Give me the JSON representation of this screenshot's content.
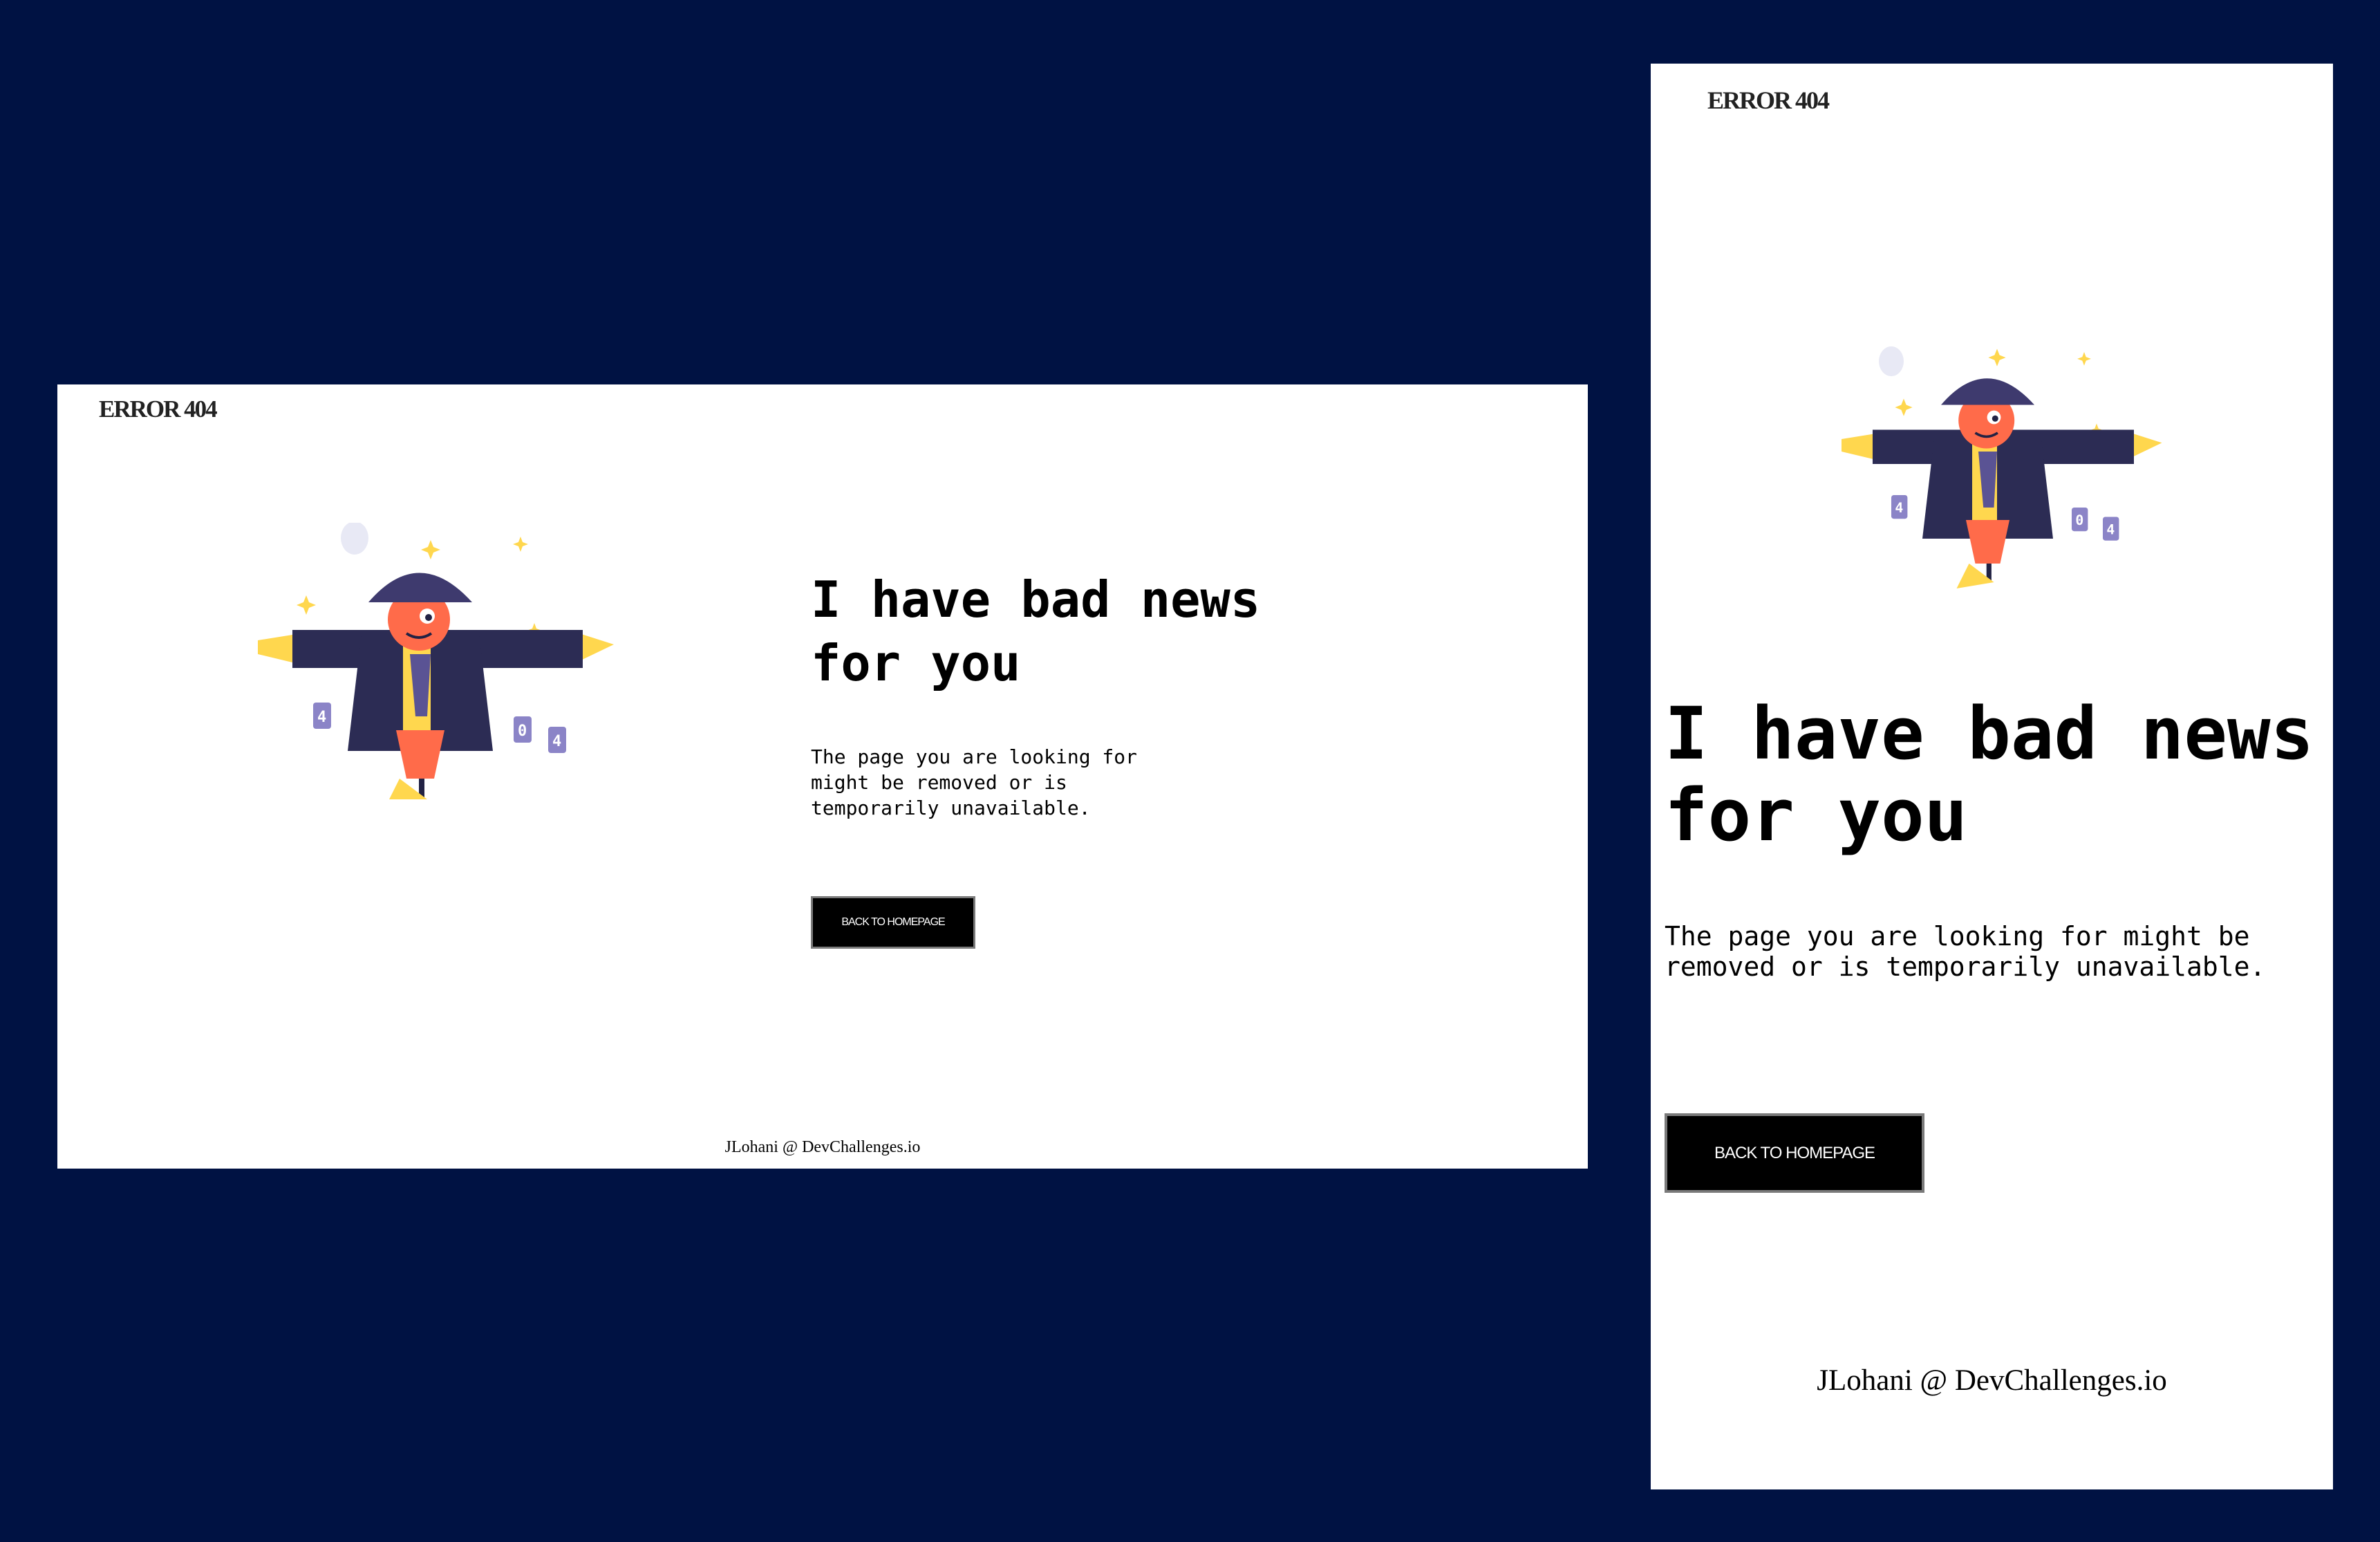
{
  "brand": "ERROR 404",
  "headline_desktop": "I have bad news for you",
  "headline_mobile": "I have bad news\nfor you",
  "description": "The page you are looking for might be removed or is temporarily unavailable.",
  "cta_label": "BACK TO HOMEPAGE",
  "footer": "JLohani @ DevChallenges.io",
  "illustration": {
    "name": "scarecrow-404-illustration",
    "can_labels": [
      "4",
      "0",
      "4"
    ]
  },
  "colors": {
    "background": "#001243",
    "card": "#FFFFFF",
    "button": "#000000",
    "coat": "#2C2C54",
    "face": "#FF6B4A",
    "straw": "#FFD74E",
    "hat": "#3E3A6E",
    "can": "#8B84C7"
  }
}
